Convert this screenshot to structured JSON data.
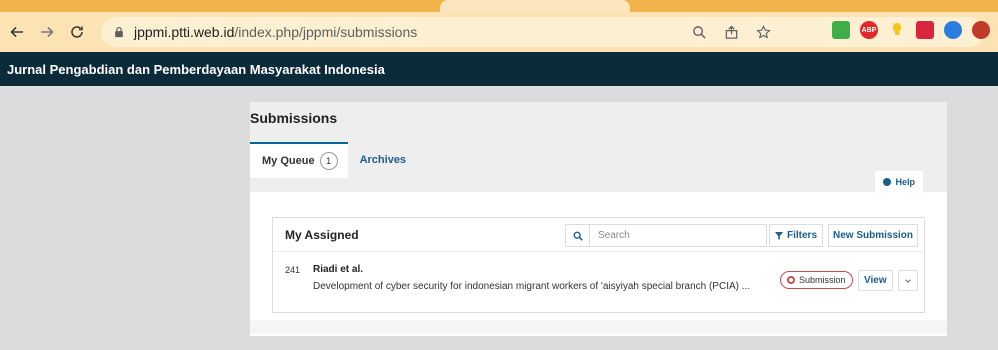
{
  "browser": {
    "url_host": "jppmi.ptti.web.id",
    "url_path": "/index.php/jppmi/submissions",
    "extensions": [
      {
        "icon": "screen-extension-icon",
        "color": "#3fae49",
        "label": ""
      },
      {
        "icon": "adblock-plus-icon",
        "color": "#e0282b",
        "label": "ABP"
      },
      {
        "icon": "lightbulb-extension-icon",
        "color": "#f5c518",
        "label": ""
      },
      {
        "icon": "grid-extension-icon",
        "color": "#d7263d",
        "label": ""
      },
      {
        "icon": "globe-extension-icon",
        "color": "#2a7de1",
        "label": ""
      },
      {
        "icon": "shield-extension-icon",
        "color": "#c0392b",
        "label": ""
      }
    ]
  },
  "site": {
    "title": "Jurnal Pengabdian dan Pemberdayaan Masyarakat Indonesia"
  },
  "page": {
    "title": "Submissions",
    "tabs": [
      {
        "label": "My Queue",
        "count": "1"
      },
      {
        "label": "Archives"
      }
    ],
    "help_label": "Help"
  },
  "card": {
    "title": "My Assigned",
    "search_placeholder": "Search",
    "filters_label": "Filters",
    "new_submission_label": "New Submission"
  },
  "submissions": [
    {
      "id": "241",
      "authors": "Riadi et al.",
      "title": "Development of cyber security for indonesian migrant workers of 'aisyiyah special branch (PCIA) ...",
      "stage": "Submission",
      "view_label": "View"
    }
  ],
  "colors": {
    "header_bg": "#0b2a3a",
    "link": "#1b5d8b",
    "stage_border": "#c94c4c",
    "chrome_bar": "#fce3b3"
  }
}
